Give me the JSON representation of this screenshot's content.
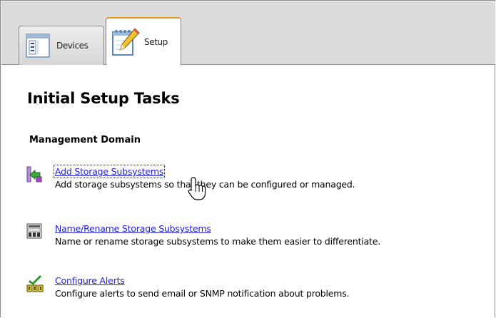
{
  "tabs": [
    {
      "label": "Devices",
      "icon": "devices-window-icon",
      "active": false
    },
    {
      "label": "Setup",
      "icon": "setup-notepad-pencil-icon",
      "active": true
    }
  ],
  "page": {
    "title": "Initial Setup Tasks",
    "section_title": "Management Domain"
  },
  "tasks": [
    {
      "icon": "add-storage-subsystems-icon",
      "link": "Add Storage Subsystems",
      "description": "Add storage subsystems so that they can be configured or managed."
    },
    {
      "icon": "rename-storage-subsystems-icon",
      "link": "Name/Rename Storage Subsystems",
      "description": "Name or rename storage subsystems to make them easier to differentiate."
    },
    {
      "icon": "configure-alerts-icon",
      "link": "Configure Alerts",
      "description": "Configure alerts to send email or SNMP notification about problems."
    }
  ],
  "colors": {
    "link": "#1f1fd4",
    "active_tab_accent": "#e09a25",
    "tabstrip_background": "#dcdcdc"
  }
}
